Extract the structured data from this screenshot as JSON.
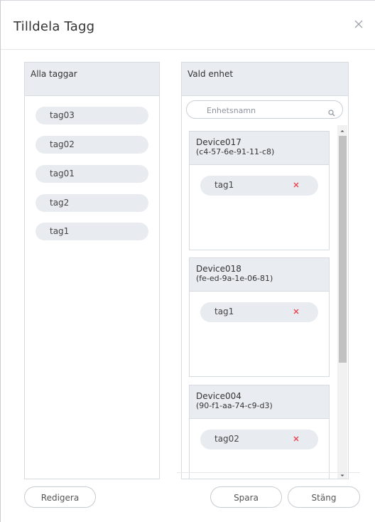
{
  "dialog": {
    "title": "Tilldela Tagg"
  },
  "all_tags_panel": {
    "header": "Alla taggar",
    "tags": [
      "tag03",
      "tag02",
      "tag01",
      "tag2",
      "tag1"
    ]
  },
  "selected_unit_panel": {
    "header": "Vald enhet",
    "search_placeholder": "Enhetsnamn",
    "devices": [
      {
        "name": "Device017",
        "mac": "(c4-57-6e-91-11-c8)",
        "tag": "tag1"
      },
      {
        "name": "Device018",
        "mac": "(fe-ed-9a-1e-06-81)",
        "tag": "tag1"
      },
      {
        "name": "Device004",
        "mac": "(90-f1-aa-74-c9-d3)",
        "tag": "tag02"
      }
    ]
  },
  "footer": {
    "edit_label": "Redigera",
    "save_label": "Spara",
    "close_label": "Stäng"
  },
  "colors": {
    "panel_header_bg": "#e9edf1",
    "tag_pill_bg": "#e8ecf0",
    "remove_x": "#e8434f",
    "border": "#d6dbe0"
  },
  "icons": {
    "close": "close-icon",
    "search": "search-icon",
    "remove": "remove-x-icon"
  }
}
